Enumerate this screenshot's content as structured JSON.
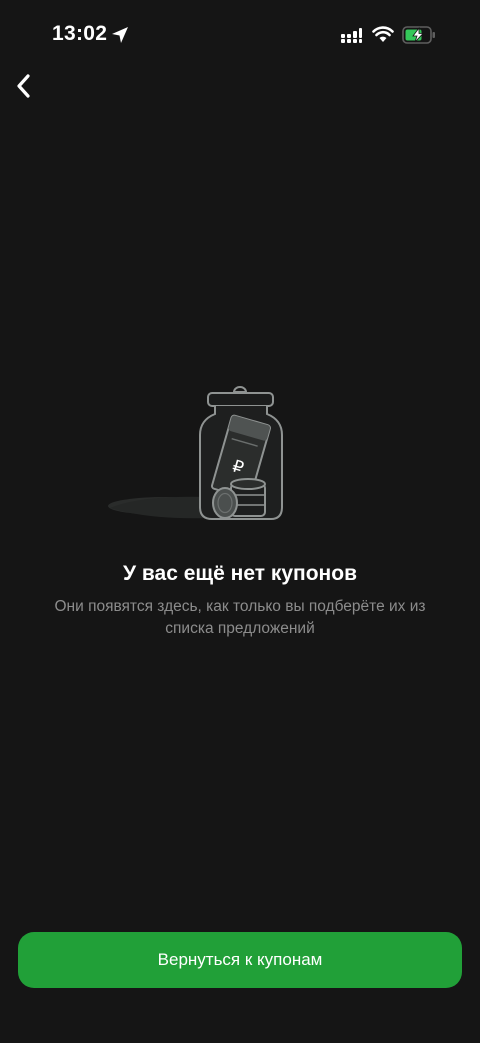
{
  "status_bar": {
    "time": "13:02",
    "icons": [
      "location-arrow-icon",
      "signal-icon",
      "wifi-icon",
      "battery-charging-icon"
    ],
    "battery_color": "#34c759"
  },
  "nav": {
    "back_icon": "chevron-left-icon"
  },
  "empty_state": {
    "illustration": "jar-with-banknote-and-coins",
    "currency_symbol": "₽",
    "title": "У вас ещё нет купонов",
    "subtitle": "Они появятся здесь, как только вы подберёте их из списка предложений"
  },
  "actions": {
    "primary_label": "Вернуться к купонам",
    "primary_color": "#21a038"
  },
  "colors": {
    "background": "#151515",
    "text_primary": "#ffffff",
    "text_secondary": "#8c8c8c"
  }
}
